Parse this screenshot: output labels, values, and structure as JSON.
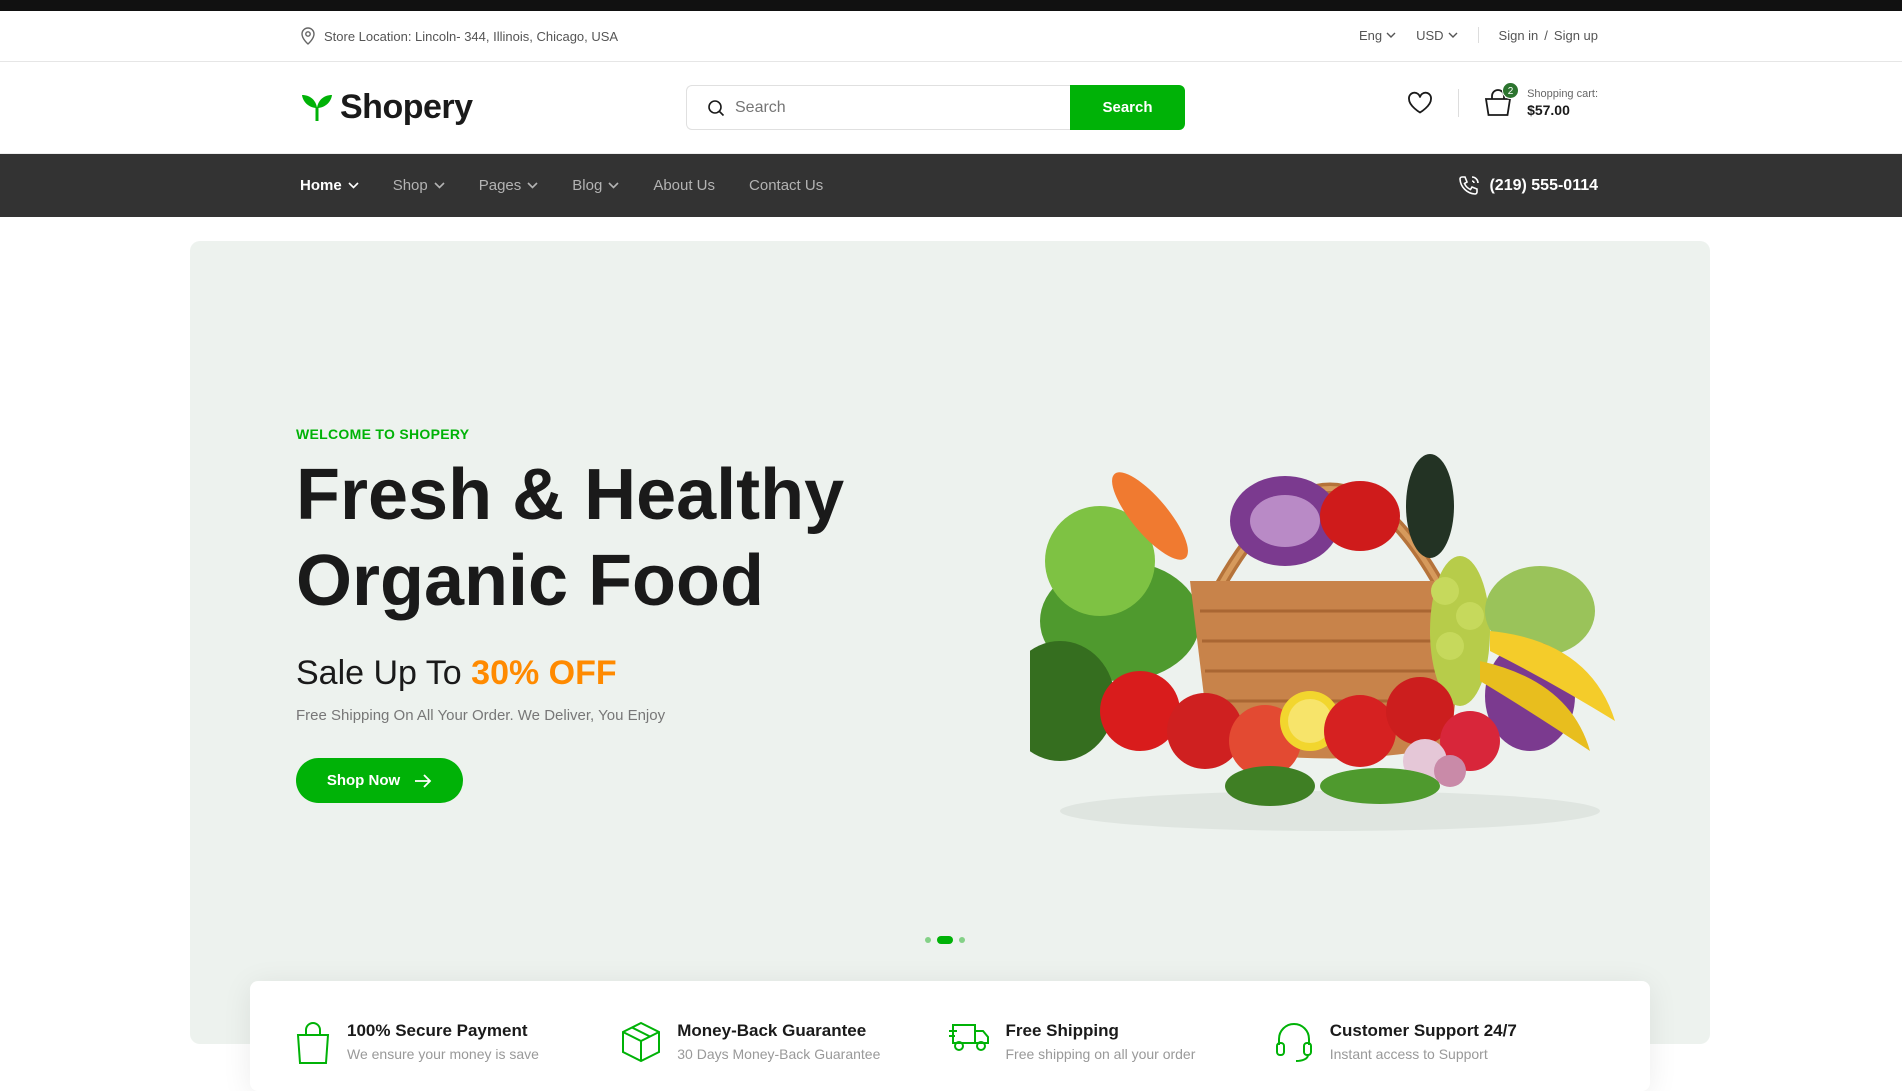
{
  "top_bar": {
    "location": "Store Location: Lincoln- 344, Illinois, Chicago, USA",
    "language": "Eng",
    "currency": "USD",
    "sign_in": "Sign in",
    "separator": "/",
    "sign_up": "Sign up"
  },
  "header": {
    "logo_text": "Shopery",
    "search_placeholder": "Search",
    "search_button": "Search",
    "cart_count": "2",
    "cart_label": "Shopping cart:",
    "cart_total": "$57.00"
  },
  "nav": {
    "items": [
      {
        "label": "Home",
        "dropdown": true,
        "active": true
      },
      {
        "label": "Shop",
        "dropdown": true
      },
      {
        "label": "Pages",
        "dropdown": true
      },
      {
        "label": "Blog",
        "dropdown": true
      },
      {
        "label": "About Us"
      },
      {
        "label": "Contact Us"
      }
    ],
    "phone": "(219) 555-0114"
  },
  "hero": {
    "eyebrow": "WELCOME TO SHOPERY",
    "title_line1": "Fresh & Healthy",
    "title_line2": "Organic Food",
    "sale_prefix": "Sale Up To ",
    "sale_value": "30% OFF",
    "subtitle": "Free Shipping On All Your Order. We Deliver, You Enjoy",
    "cta": "Shop Now",
    "slide_count": 3,
    "active_slide": 2
  },
  "features": [
    {
      "icon": "shopping-bag-icon",
      "title": "100% Secure Payment",
      "subtitle": "We ensure your money is save"
    },
    {
      "icon": "package-box-icon",
      "title": "Money-Back Guarantee",
      "subtitle": "30 Days Money-Back Guarantee"
    },
    {
      "icon": "delivery-truck-icon",
      "title": "Free Shipping",
      "subtitle": "Free shipping on all your order"
    },
    {
      "icon": "headphones-icon",
      "title": "Customer Support 24/7",
      "subtitle": "Instant access to Support"
    }
  ],
  "colors": {
    "brand_green": "#00b207",
    "dark_green": "#2c742f",
    "accent_orange": "#ff8a00",
    "nav_bg": "#333333",
    "hero_bg": "#edf2ee"
  }
}
